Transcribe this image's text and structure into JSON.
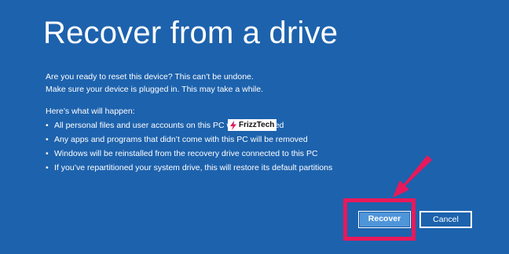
{
  "title": "Recover from a drive",
  "intro": {
    "line1": "Are you ready to reset this device? This can’t be undone.",
    "line2": "Make sure your device is plugged in. This may take a while."
  },
  "happen": {
    "heading": "Here’s what will happen:",
    "items": [
      "All personal files and user accounts on this PC will be removed",
      "Any apps and programs that didn’t come with this PC will be removed",
      "Windows will be reinstalled from the recovery drive connected to this PC",
      "If you’ve repartitioned your system drive, this will restore its default partitions"
    ]
  },
  "watermark": {
    "text": "FrizzTech"
  },
  "buttons": {
    "recover": "Recover",
    "cancel": "Cancel"
  },
  "colors": {
    "background": "#1d62ad",
    "recover_button": "#4f95d9",
    "annotation": "#e8195a",
    "text": "#ffffff"
  },
  "icons": {
    "annotation_arrow": "arrow-icon",
    "watermark_logo": "frizztech-logo-icon"
  }
}
